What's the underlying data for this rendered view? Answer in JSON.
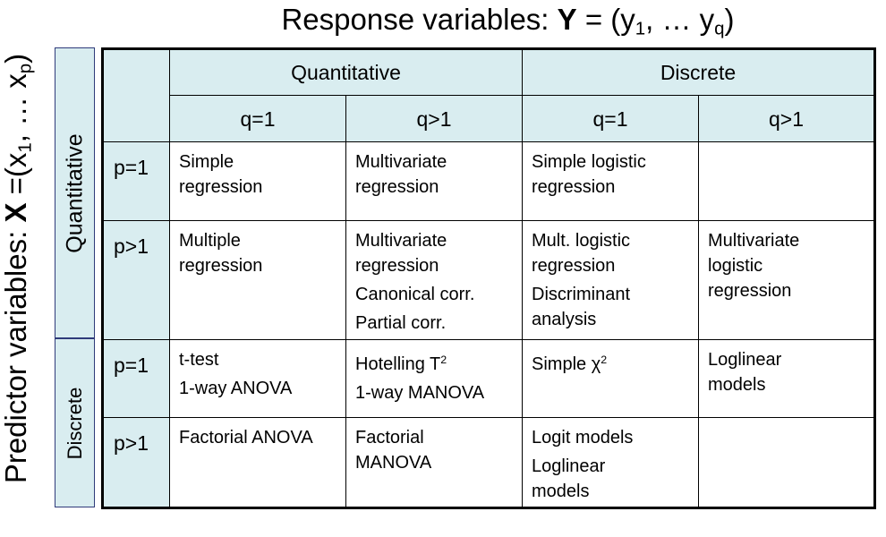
{
  "title": {
    "prefix": "Response variables: ",
    "bold": "Y",
    "mid": " = (y",
    "sub1": "1",
    "dots": ", … y",
    "subq": "q",
    "close": ")"
  },
  "side_title": {
    "prefix": "Predictor variables: ",
    "bold": "X",
    "mid": " =(x",
    "sub1": "1",
    "dots": ", … x",
    "subp": "p",
    "close": ")"
  },
  "bands": {
    "quantitative": "Quantitative",
    "discrete": "Discrete"
  },
  "header": {
    "group_quant": "Quantitative",
    "group_disc": "Discrete",
    "q1": "q=1",
    "qgt1": "q>1"
  },
  "rows": {
    "p1": "p=1",
    "pgt1": "p>1"
  },
  "cells": {
    "r1c1": [
      "Simple",
      "regression"
    ],
    "r1c2": [
      "Multivariate",
      "regression"
    ],
    "r1c3": [
      "Simple logistic",
      "regression"
    ],
    "r2c1": [
      "Multiple",
      "regression"
    ],
    "r2c2a": [
      "Multivariate",
      "regression"
    ],
    "r2c2b": "Canonical corr.",
    "r2c2c": "Partial corr.",
    "r2c3a": [
      "Mult. logistic",
      "regression"
    ],
    "r2c3b": [
      "Discriminant",
      "analysis"
    ],
    "r2c4": [
      "Multivariate",
      "logistic",
      "regression"
    ],
    "r3c1a": "t-test",
    "r3c1b": "1-way ANOVA",
    "r3c2a": "Hotelling T",
    "r3c2a_sup": "2",
    "r3c2b": "1-way MANOVA",
    "r3c3": "Simple χ",
    "r3c3_sup": "2",
    "r3c4": [
      "Loglinear",
      "models"
    ],
    "r4c1": "Factorial ANOVA",
    "r4c2": [
      "Factorial",
      "MANOVA"
    ],
    "r4c3a": "Logit models",
    "r4c3b": [
      "Loglinear",
      "models"
    ]
  }
}
